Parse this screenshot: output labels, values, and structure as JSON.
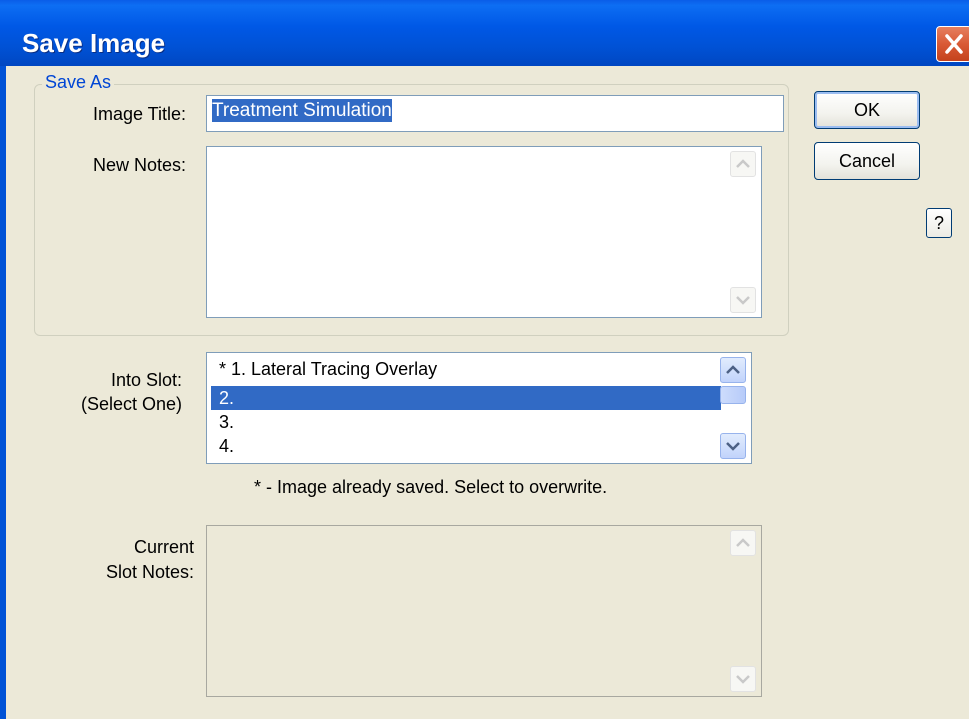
{
  "dialog": {
    "title": "Save Image"
  },
  "save_as": {
    "legend": "Save As",
    "image_title_label": "Image Title:",
    "image_title_value": "Treatment Simulation",
    "new_notes_label": "New Notes:",
    "new_notes_value": ""
  },
  "slot": {
    "label_line1": "Into Slot:",
    "label_line2": "(Select One)",
    "items": [
      "* 1. Lateral Tracing Overlay",
      "2.",
      "3.",
      "4."
    ],
    "selected_index": 1,
    "footnote": "* - Image already saved. Select to overwrite."
  },
  "current_notes": {
    "label_line1": "Current",
    "label_line2": "Slot Notes:",
    "value": ""
  },
  "buttons": {
    "ok": "OK",
    "cancel": "Cancel",
    "help": "?"
  },
  "icons": {
    "close": "close-icon",
    "scroll_up": "chevron-up-icon",
    "scroll_down": "chevron-down-icon"
  },
  "colors": {
    "titlebar": "#0052d6",
    "selection": "#316ac5",
    "legend": "#0046d5",
    "close": "#d95a35"
  }
}
